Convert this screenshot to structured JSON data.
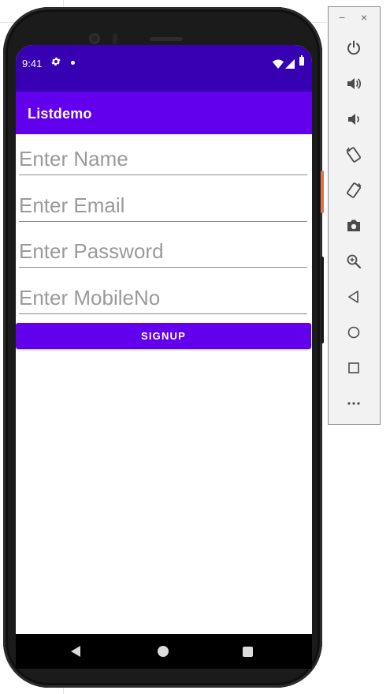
{
  "status_bar": {
    "time": "9:41",
    "settings_icon": "gear-icon",
    "wifi_icon": "wifi-icon",
    "signal_icon": "signal-icon",
    "battery_icon": "battery-icon"
  },
  "app_bar": {
    "title": "Listdemo"
  },
  "form": {
    "name_placeholder": "Enter Name",
    "email_placeholder": "Enter Email",
    "password_placeholder": "Enter Password",
    "mobile_placeholder": "Enter MobileNo",
    "name_value": "",
    "email_value": "",
    "password_value": "",
    "mobile_value": "",
    "signup_label": "SIGNUP"
  },
  "colors": {
    "status_bar": "#3700b3",
    "primary": "#6200ee",
    "placeholder": "#9a9a9a"
  },
  "navigation_bar": {
    "icons": [
      "back-icon",
      "home-icon",
      "recents-icon"
    ]
  },
  "emulator_toolbar": {
    "window_controls": [
      "minimize-icon",
      "close-icon"
    ],
    "buttons": [
      "power-icon",
      "volume-up-icon",
      "volume-down-icon",
      "rotate-left-icon",
      "rotate-right-icon",
      "camera-icon",
      "zoom-icon",
      "back-icon",
      "home-icon",
      "overview-icon",
      "more-icon"
    ]
  }
}
